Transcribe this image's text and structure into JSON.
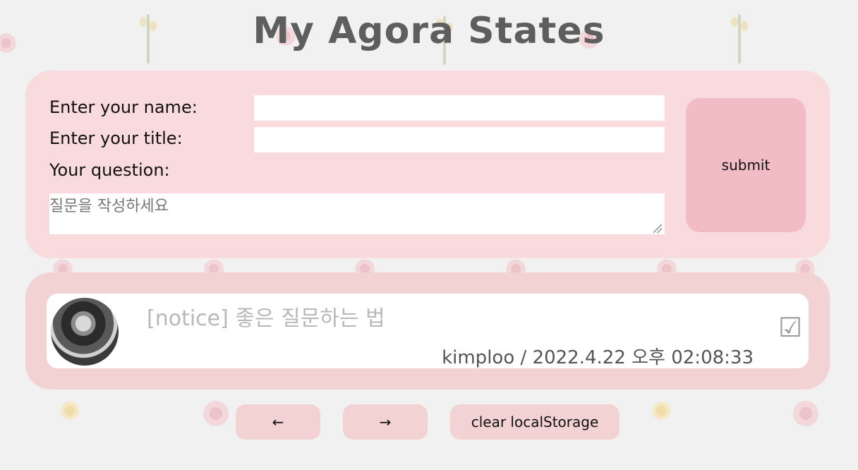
{
  "page": {
    "title": "My Agora States"
  },
  "form": {
    "name_label": "Enter your name:",
    "name_value": "",
    "title_label": "Enter your title:",
    "title_value": "",
    "question_label": "Your question:",
    "question_placeholder": "질문을 작성하세요",
    "submit_label": "submit"
  },
  "discussions": [
    {
      "title": "[notice] 좋은 질문하는 법",
      "author": "kimploo",
      "separator": " / ",
      "created_at": "2022.4.22 오후 02:08:33",
      "answered_icon": "checkbox-icon",
      "answered_glyph": "☑"
    }
  ],
  "pagination": {
    "prev_label": "←",
    "next_label": "→",
    "clear_label": "clear localStorage"
  },
  "colors": {
    "background": "#f2f1f1",
    "form_panel": "#f9dbdd",
    "list_panel": "#f3d2d3",
    "submit_button": "#f2bcc5",
    "title_text": "#5e5e5e"
  }
}
